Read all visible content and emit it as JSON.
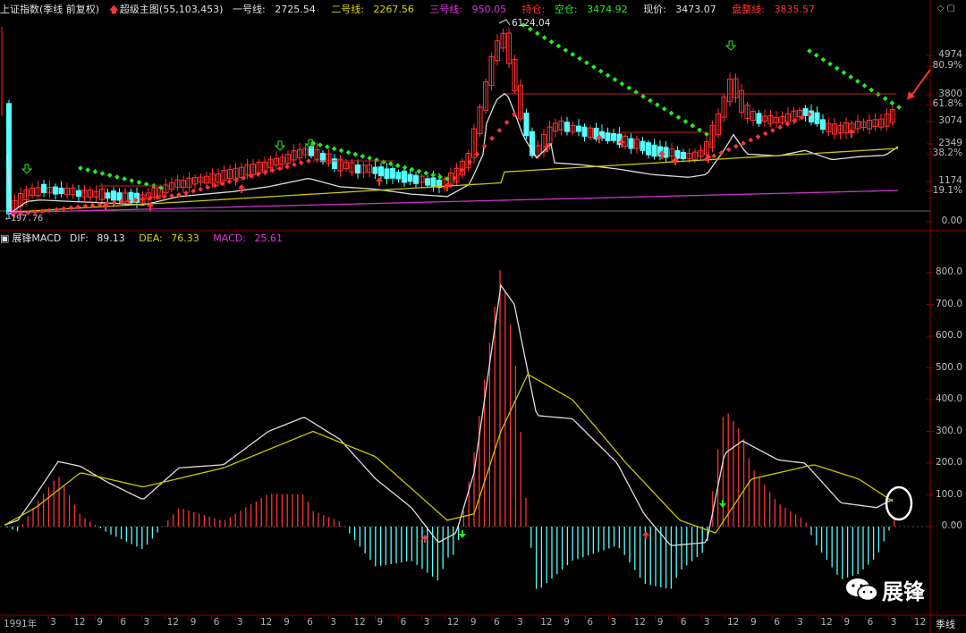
{
  "header": {
    "title": "上证指数(季线 前复权)",
    "indicator": "超级主图(55,103,453)",
    "line1_label": "一号线:",
    "line1_value": "2725.54",
    "line2_label": "二号线:",
    "line2_value": "2267.56",
    "line3_label": "三号线:",
    "line3_value": "950.05",
    "hold_label": "持仓:",
    "empty_label": "空仓:",
    "empty_value": "3474.92",
    "price_label": "现价:",
    "price_value": "3473.07",
    "stop_label": "盘整线:",
    "stop_value": "3835.57"
  },
  "main_chart": {
    "y_ticks": [
      "4974",
      "80.9%",
      "3800",
      "61.8%",
      "3074",
      "2349",
      "38.2%",
      "1174",
      "19.1%",
      "0.00"
    ],
    "peak_label": "6124.04",
    "low_label": "197.76"
  },
  "macd": {
    "name": "展锋MACD",
    "dif_label": "DIF:",
    "dif_value": "89.13",
    "dea_label": "DEA:",
    "dea_value": "76.33",
    "macd_label": "MACD:",
    "macd_value": "25.61",
    "y_ticks": [
      "800.0",
      "700.0",
      "600.0",
      "500.0",
      "400.0",
      "300.0",
      "200.0",
      "100.0",
      "0.00"
    ]
  },
  "x_axis": {
    "labels": [
      "1991年",
      "3",
      "12",
      "9",
      "6",
      "3",
      "12",
      "9",
      "6",
      "3",
      "12",
      "9",
      "6",
      "3",
      "12",
      "9",
      "6",
      "3",
      "12",
      "9",
      "6",
      "3",
      "12",
      "9",
      "6",
      "3",
      "12",
      "9",
      "6",
      "3",
      "12",
      "9",
      "6",
      "3",
      "12",
      "9",
      "6",
      "3",
      "12"
    ],
    "period": "季线"
  },
  "watermark": {
    "text": "展锋"
  },
  "colors": {
    "up": "#ff3333",
    "down": "#54ffff",
    "dif": "#dddddd",
    "dea": "#c8c800",
    "purple": "#cc33cc",
    "green_dot": "#22ee22"
  }
}
